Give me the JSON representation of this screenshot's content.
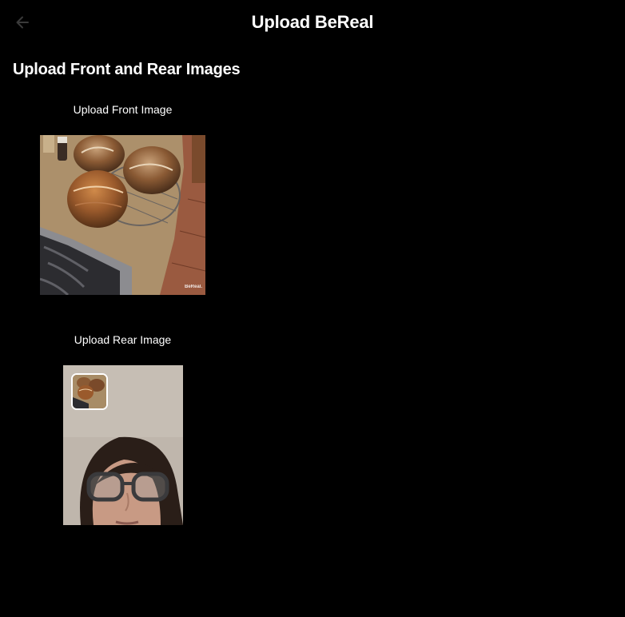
{
  "header": {
    "title": "Upload BeReal",
    "back_icon": "arrow-left-icon"
  },
  "main": {
    "section_title": "Upload Front and Rear Images",
    "front": {
      "label": "Upload Front Image",
      "watermark": "BeReal."
    },
    "rear": {
      "label": "Upload Rear Image"
    }
  },
  "colors": {
    "background": "#000000",
    "text": "#ffffff",
    "back_icon": "#3a3a3a"
  }
}
